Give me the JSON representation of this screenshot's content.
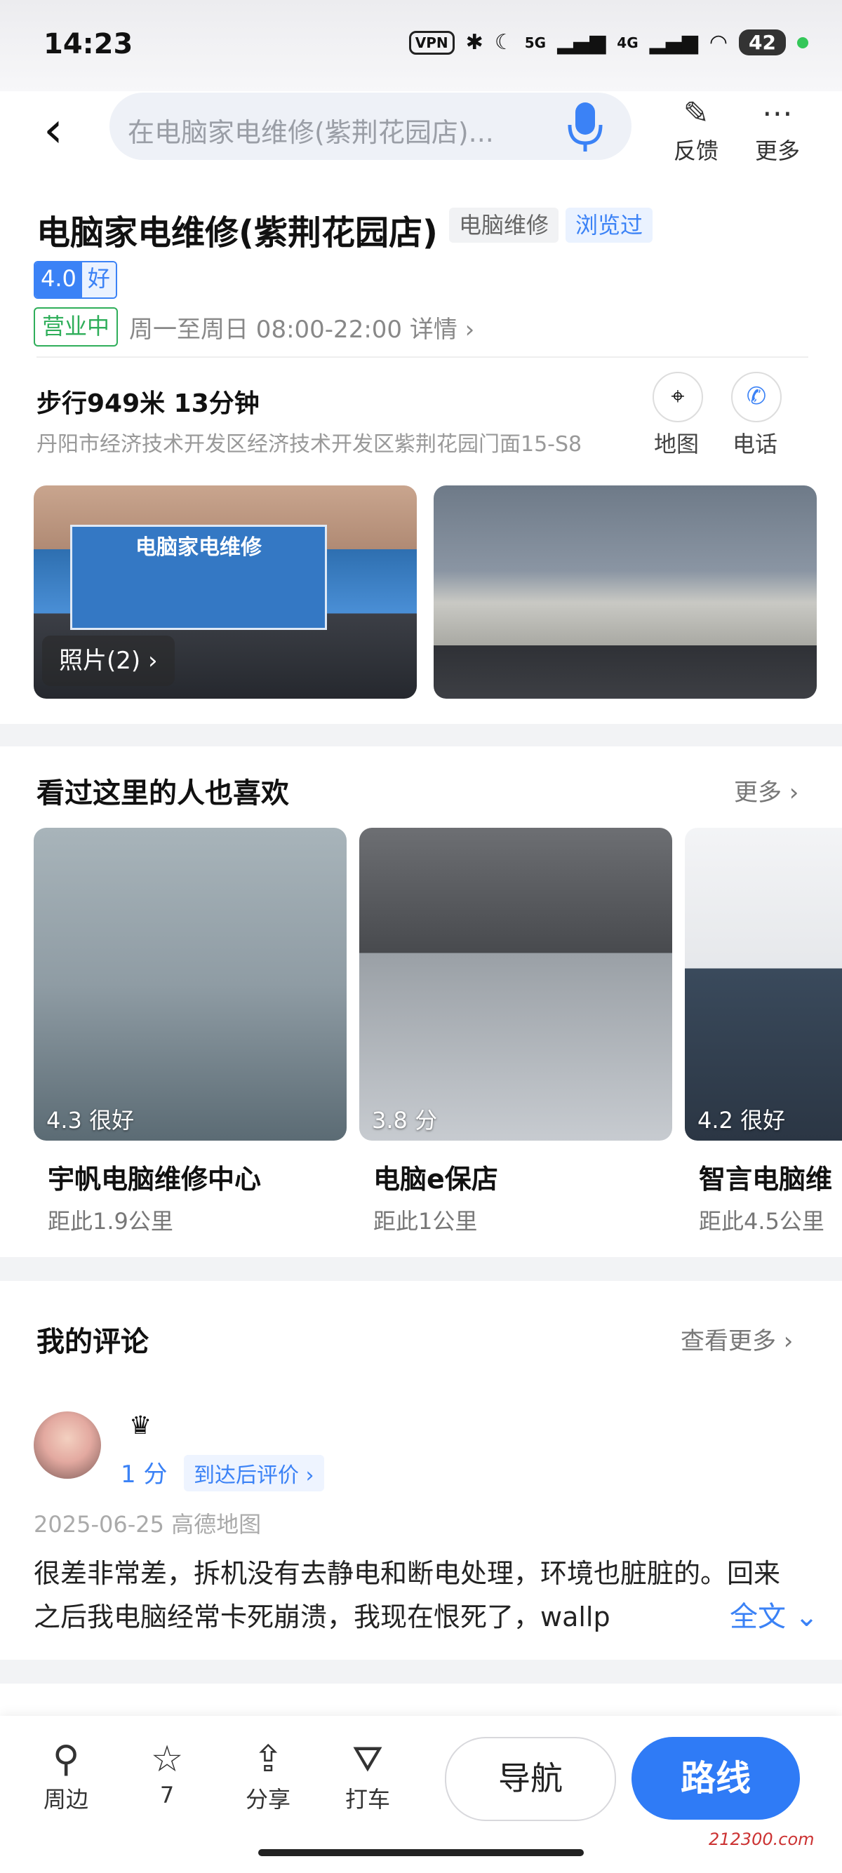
{
  "status": {
    "time": "14:23",
    "vpn": "VPN",
    "net1": "5G",
    "net2": "4G",
    "battery": "42"
  },
  "header": {
    "search_text": "在电脑家电维修(紫荆花园店)...",
    "feedback_label": "反馈",
    "more_label": "更多"
  },
  "poi": {
    "name": "电脑家电维修(紫荆花园店)",
    "category_tag": "电脑维修",
    "viewed_tag": "浏览过",
    "rating": "4.0",
    "rating_label": "好",
    "status": "营业中",
    "hours": "周一至周日 08:00-22:00 详情 ›",
    "walk": "步行949米 13分钟",
    "address": "丹阳市经济技术开发区经济技术开发区紫荆花园门面15-S8",
    "map_label": "地图",
    "phone_label": "电话",
    "photos_label": "照片(2) ›",
    "shop_sign": "电脑家电维修"
  },
  "recommend": {
    "title": "看过这里的人也喜欢",
    "more": "更多 ›",
    "items": [
      {
        "score": "4.3 很好",
        "name": "宇帆电脑维修中心",
        "distance": "距此1.9公里"
      },
      {
        "score": "3.8 分",
        "name": "电脑e保店",
        "distance": "距此1公里"
      },
      {
        "score": "4.2 很好",
        "name": "智言电脑维",
        "distance": "距此4.5公里"
      }
    ]
  },
  "reviews": {
    "title": "我的评论",
    "more": "查看更多 ›",
    "score": "1 分",
    "after_review": "到达后评价 ›",
    "date_source": "2025-06-25 高德地图",
    "text": "很差非常差，拆机没有去静电和断电处理，环境也脏脏的。回来之后我电脑经常卡死崩溃，我现在恨死了，wallp",
    "full_text": "全文 ⌄"
  },
  "bottom": {
    "nearby": "周边",
    "favorites": "7",
    "share": "分享",
    "taxi": "打车",
    "navigate": "导航",
    "route": "路线"
  },
  "watermark": "212300.com"
}
